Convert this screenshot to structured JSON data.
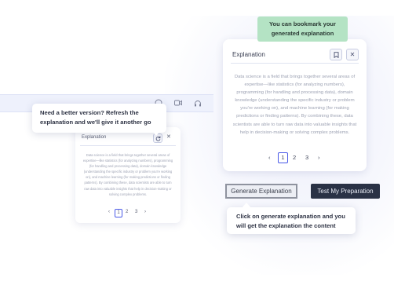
{
  "tooltips": {
    "bookmark": "You can bookmark your generated explanation",
    "refresh": "Need a better version? Refresh the explanation and we'll give it another go",
    "generate": "Click on generate explanation and you will get the explanation the content"
  },
  "main_card": {
    "title": "Explanation",
    "body": "Data science is a field that brings together several areas of expertise—like statistics (for analyzing numbers), programming (for handling and processing data), domain knowledge (understanding the specific industry or problem you're working on), and machine learning (for making predictions or finding patterns). By combining these, data scientists are able to turn raw data into valuable insights that help in decision-making or solving complex problems.",
    "pages": [
      "1",
      "2",
      "3"
    ],
    "active_page": 1,
    "prev": "‹",
    "next": "›",
    "bookmark_icon": "bookmark-icon",
    "close_icon": "close-icon"
  },
  "small_card": {
    "title": "Explanation",
    "body": "Data science is a field that brings together several areas of expertise—like statistics (for analyzing numbers), programming (for handling and processing data), domain knowledge (understanding the specific industry or problem you're working on), and machine learning (for making predictions or finding patterns). By combining these, data scientists are able to turn raw data into valuable insights that help in decision-making or solving complex problems.",
    "pages": [
      "1",
      "2",
      "3"
    ],
    "active_page": 1,
    "prev": "‹",
    "next": "›",
    "refresh_icon": "refresh-icon",
    "close_icon": "close-icon"
  },
  "toolbar_icons": [
    "info-icon",
    "video-icon",
    "headset-icon"
  ],
  "actions": {
    "generate_label": "Generate Explanation",
    "prep_label": "Test  My Preparation"
  },
  "colors": {
    "accent": "#4a5ae8",
    "tooltip_green": "#b4e3c4",
    "dark_button": "#2a3245"
  }
}
